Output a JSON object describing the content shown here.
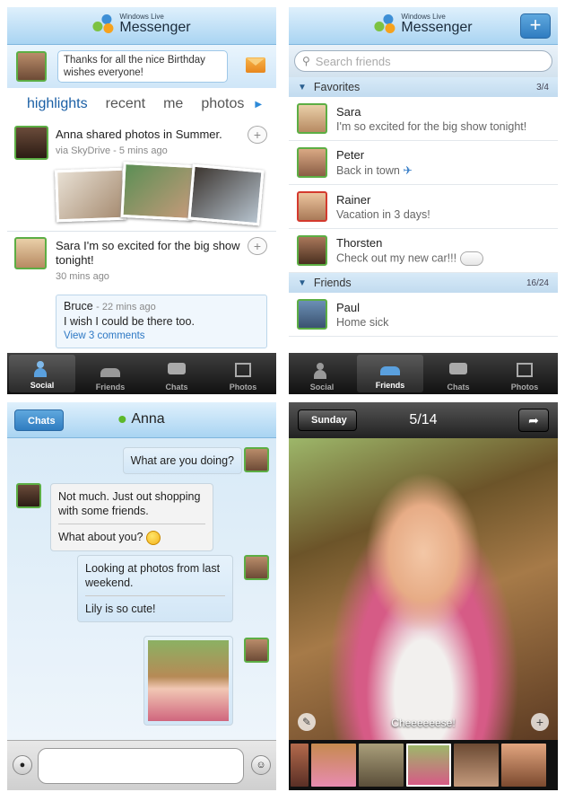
{
  "brand": {
    "small": "Windows Live",
    "big": "Messenger"
  },
  "social": {
    "status_text": "Thanks for all the nice Birthday wishes everyone!",
    "pivots": [
      "highlights",
      "recent",
      "me",
      "photos"
    ],
    "feed1": {
      "name": "Anna",
      "action": "shared photos in",
      "album": "Summer.",
      "meta": "via SkyDrive - 5 mins ago"
    },
    "feed2": {
      "name": "Sara",
      "text": "I'm so excited for the big show tonight!",
      "meta": "30 mins ago",
      "reply": {
        "name": "Bruce",
        "time": "- 22 mins ago",
        "text": "I wish I could be there too.",
        "link": "View 3 comments"
      }
    }
  },
  "tabs": [
    "Social",
    "Friends",
    "Chats",
    "Photos"
  ],
  "friends": {
    "search_placeholder": "Search friends",
    "favorites": {
      "label": "Favorites",
      "count": "3/4"
    },
    "friends_group": {
      "label": "Friends",
      "count": "16/24"
    },
    "contacts": [
      {
        "name": "Sara",
        "status": "I'm so excited for the big show tonight!"
      },
      {
        "name": "Peter",
        "status": "Back in town"
      },
      {
        "name": "Rainer",
        "status": "Vacation in 3 days!"
      },
      {
        "name": "Thorsten",
        "status": "Check out my new car!!!"
      },
      {
        "name": "Paul",
        "status": "Home sick"
      }
    ]
  },
  "chat": {
    "back": "Chats",
    "contact": "Anna",
    "m1": "What are you doing?",
    "m2a": "Not much. Just out shopping with some friends.",
    "m2b": "What about you?",
    "m3a": "Looking at photos from last weekend.",
    "m3b": "Lily is so cute!"
  },
  "photo": {
    "back": "Sunday",
    "counter": "5/14",
    "caption": "Cheeeeeese!"
  }
}
